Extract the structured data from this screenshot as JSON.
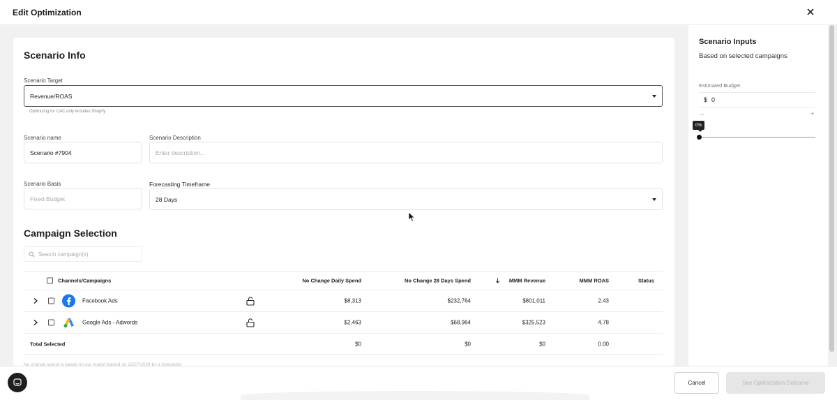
{
  "header": {
    "title": "Edit Optimization"
  },
  "scenario_info": {
    "section_title": "Scenario Info",
    "target_label": "Scenario Target",
    "target_value": "Revenue/ROAS",
    "target_helper": "Optimizing for CAC only includes Shopify",
    "name_label": "Scenario name",
    "name_value": "Scenario #7904",
    "description_label": "Scenario Description",
    "description_placeholder": "Enter description...",
    "basis_label": "Scenario Basis",
    "basis_placeholder": "Fixed Budget",
    "timeframe_label": "Forecasting Timeframe",
    "timeframe_value": "28 Days"
  },
  "campaign_selection": {
    "section_title": "Campaign Selection",
    "search_placeholder": "Search campaign(s)",
    "columns": {
      "channels": "Channels/Campaigns",
      "daily_spend": "No Change Daily Spend",
      "period_spend": "No Change 28 Days Spend",
      "revenue": "MMM Revenue",
      "roas": "MMM ROAS",
      "status": "Status"
    },
    "rows": [
      {
        "name": "Facebook Ads",
        "daily": "$8,313",
        "period": "$232,764",
        "revenue": "$801,011",
        "roas": "2.43",
        "icon": "facebook-icon"
      },
      {
        "name": "Google Ads - Adwords",
        "daily": "$2,463",
        "period": "$68,964",
        "revenue": "$325,523",
        "roas": "4.78",
        "icon": "google-ads-icon"
      }
    ],
    "total": {
      "label": "Total Selected",
      "daily": "$0",
      "period": "$0",
      "revenue": "$0",
      "roas": "0.00"
    },
    "note": "No change spend is based on our model trained on 12/27/2024 by a forecaster"
  },
  "scenario_inputs": {
    "title": "Scenario Inputs",
    "subtitle": "Based on selected campaigns",
    "budget_label": "Estimated Budget",
    "currency": "$",
    "budget_value": "0",
    "minus": "–",
    "plus": "+",
    "slider_percent": "0%"
  },
  "footer": {
    "cancel_label": "Cancel",
    "primary_label": "See Optimization Outcome"
  },
  "colors": {
    "facebook": "#1877F2",
    "google_blue": "#4285F4",
    "google_yellow": "#FBBC04"
  }
}
